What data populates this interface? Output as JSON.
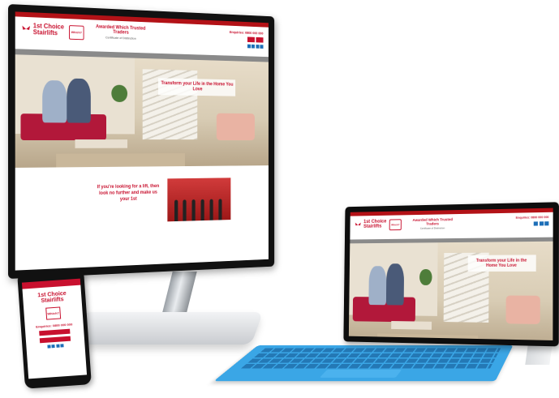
{
  "site": {
    "brand_line1": "1st Choice",
    "brand_line2": "Stairlifts",
    "which_badge": "Which?",
    "award_title": "Awarded Which Trusted Traders",
    "award_sub": "Certificate of Distinction",
    "enquiries": "Enquiries: 0800 000 000",
    "hero_title": "Transform your Life in the Home You Love",
    "looking": "If you're looking for a lift, then look no further and make us your 1st"
  },
  "colors": {
    "brand_red": "#c8102e",
    "keyboard_blue": "#3aa6e6",
    "device_black": "#111111"
  }
}
